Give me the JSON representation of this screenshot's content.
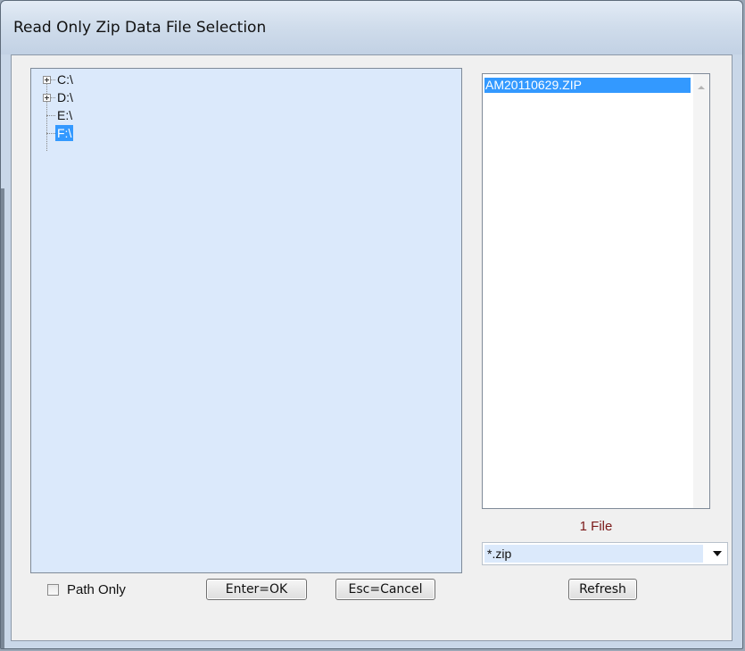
{
  "window": {
    "title": "Read Only Zip Data File Selection"
  },
  "tree": {
    "items": [
      {
        "label": "C:\\",
        "expandable": true,
        "selected": false
      },
      {
        "label": "D:\\",
        "expandable": true,
        "selected": false
      },
      {
        "label": "E:\\",
        "expandable": false,
        "selected": false
      },
      {
        "label": "F:\\",
        "expandable": false,
        "selected": true
      }
    ]
  },
  "files": {
    "items": [
      {
        "name": "AM20110629.ZIP",
        "selected": true
      }
    ],
    "count_label": "1 File"
  },
  "filter": {
    "value": "*.zip"
  },
  "options": {
    "path_only_label": "Path Only",
    "path_only_checked": false
  },
  "buttons": {
    "ok": "Enter=OK",
    "cancel": "Esc=Cancel",
    "refresh": "Refresh"
  },
  "icons": [
    "plus-expander-icon",
    "chevron-down-icon",
    "scroll-up-icon"
  ],
  "colors": {
    "selection": "#3399ff",
    "tree_bg": "#dbe9fb",
    "count_text": "#7b1a1a"
  }
}
